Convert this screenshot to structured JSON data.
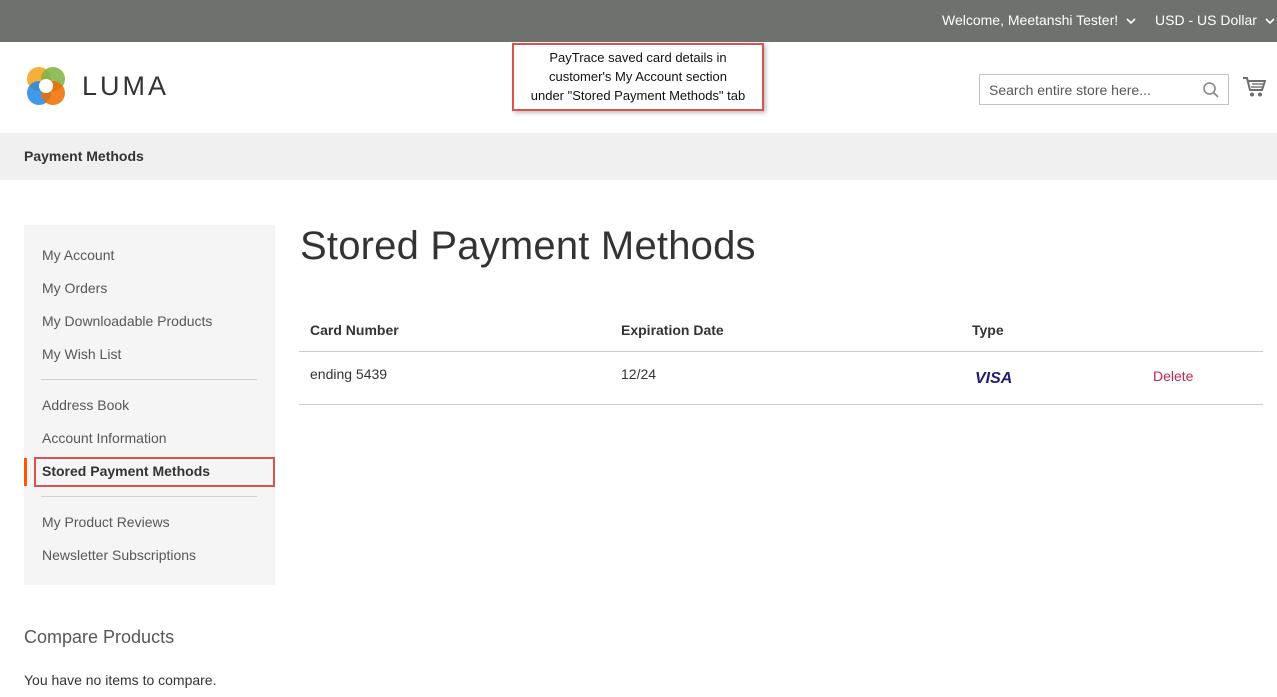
{
  "topbar": {
    "welcome": "Welcome, Meetanshi Tester!",
    "currency": "USD - US Dollar"
  },
  "header": {
    "logo_text": "LUMA",
    "search_placeholder": "Search entire store here...",
    "search_icon": "search-icon",
    "cart_icon": "cart-icon"
  },
  "annotation": {
    "line1": "PayTrace saved card details in",
    "line2": "customer's My Account section",
    "line3": "under \"Stored Payment Methods\" tab",
    "border_color": "#d9534f"
  },
  "title_bar": {
    "label": "Payment Methods"
  },
  "sidebar": {
    "group1": [
      "My Account",
      "My Orders",
      "My Downloadable Products",
      "My Wish List"
    ],
    "group2": [
      "Address Book",
      "Account Information"
    ],
    "active": "Stored Payment Methods",
    "group3": [
      "My Product Reviews",
      "Newsletter Subscriptions"
    ],
    "active_color": "#ff5501"
  },
  "compare": {
    "title": "Compare Products",
    "empty_text": "You have no items to compare."
  },
  "main": {
    "heading": "Stored Payment Methods",
    "table": {
      "headers": [
        "Card Number",
        "Expiration Date",
        "Type"
      ],
      "rows": [
        {
          "card_number": "ending 5439",
          "expiration": "12/24",
          "type_icon": "visa-logo-icon",
          "type": "VISA",
          "action": "Delete"
        }
      ]
    },
    "link_color": "#c3284c"
  }
}
